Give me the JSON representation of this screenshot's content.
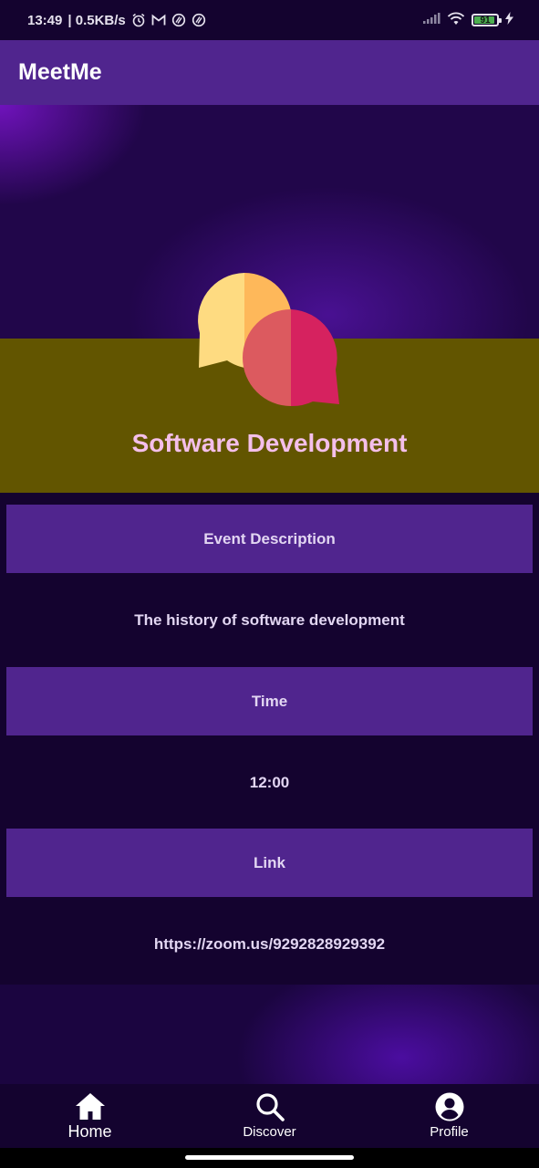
{
  "status_bar": {
    "time": "13:49",
    "network_speed": "| 0.5KB/s",
    "icons_left": [
      "alarm-icon",
      "gmail-icon",
      "sync-icon",
      "sync-icon"
    ],
    "battery_level": "91"
  },
  "app_bar": {
    "title": "MeetMe"
  },
  "event": {
    "icon": "chat-bubbles-icon",
    "title": "Software Development",
    "sections": [
      {
        "label": "Event Description",
        "value": "The history of software development"
      },
      {
        "label": "Time",
        "value": "12:00"
      },
      {
        "label": "Link",
        "value": "https://zoom.us/9292828929392"
      }
    ]
  },
  "bottom_nav": {
    "items": [
      {
        "label": "Home",
        "icon": "home-icon",
        "active": true
      },
      {
        "label": "Discover",
        "icon": "search-icon",
        "active": false
      },
      {
        "label": "Profile",
        "icon": "account-icon",
        "active": false
      }
    ]
  },
  "colors": {
    "background": "#14032f",
    "app_bar": "#50258e",
    "header_band": "#625500",
    "title_text": "#f4bfea",
    "section_header": "#50258e"
  }
}
